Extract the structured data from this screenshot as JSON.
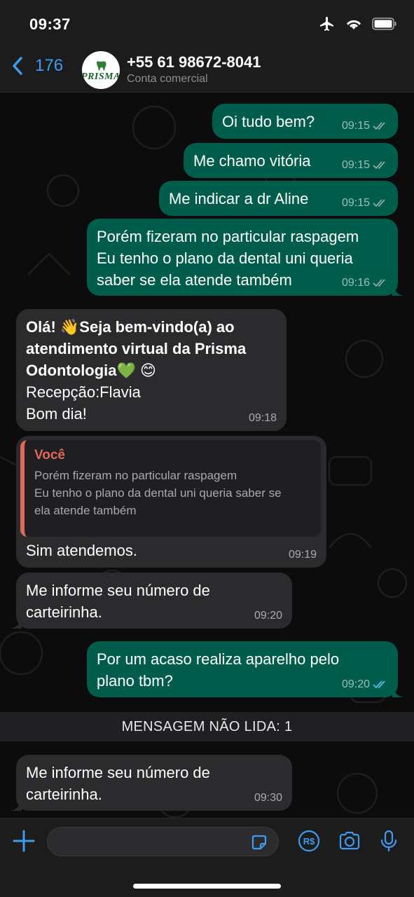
{
  "status_bar": {
    "time": "09:37"
  },
  "header": {
    "back_count": "176",
    "avatar_label": "PRISMA",
    "contact_name": "+55 61 98672-8041",
    "contact_subtitle": "Conta comercial"
  },
  "messages": [
    {
      "text": "Oi tudo bem?",
      "time": "09:15"
    },
    {
      "text": "Me chamo vitória",
      "time": "09:15"
    },
    {
      "text": "Me indicar a dr Aline",
      "time": "09:15"
    },
    {
      "line1": "Porém fizeram no particular raspagem",
      "line2": "Eu tenho o plano da dental uni queria",
      "line3": "saber se ela atende também",
      "time": "09:16"
    },
    {
      "bold1": "Olá! 👋Seja bem-vindo(a) ao",
      "bold2": "atendimento virtual da Prisma",
      "bold3": "Odontologia💚 😊",
      "line4": "Recepção:Flavia",
      "line5": "Bom dia!",
      "time": "09:18"
    },
    {
      "quote_author": "Você",
      "quote_line1": "Porém fizeram no particular raspagem",
      "quote_line2": "Eu tenho o plano da dental uni queria saber se",
      "quote_line3": "ela atende também",
      "text": "Sim atendemos.",
      "time": "09:19"
    },
    {
      "line1": "Me informe seu número de",
      "line2": "carteirinha.",
      "time": "09:20"
    },
    {
      "line1": "Por um acaso realiza aparelho pelo",
      "line2": "plano tbm?",
      "time": "09:20"
    },
    {
      "line1": "Me informe seu número de",
      "line2": "carteirinha.",
      "time": "09:30"
    }
  ],
  "unread_banner": "MENSAGEM NÃO LIDA: 1",
  "colors": {
    "outgoing": "#005c4b",
    "incoming": "#2b2b2d",
    "accent": "#3e9bf0",
    "read_ticks": "#53bdeb"
  },
  "icons": [
    "airplane-icon",
    "wifi-icon",
    "battery-icon",
    "back-chevron-icon",
    "plus-icon",
    "sticker-icon",
    "payment-icon",
    "camera-icon",
    "microphone-icon"
  ]
}
